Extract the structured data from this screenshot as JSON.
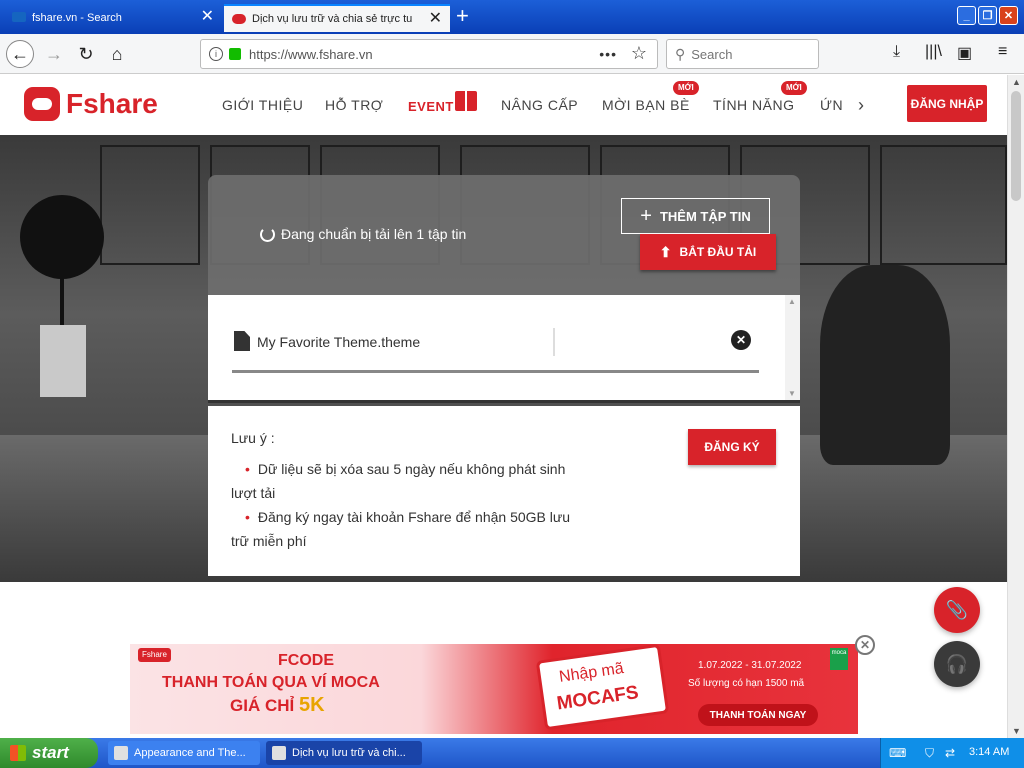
{
  "browser": {
    "tabs": [
      {
        "label": "fshare.vn - Search",
        "active": false
      },
      {
        "label": "Dịch vụ lưu trữ và chia sẻ trực tuyến",
        "active": true
      }
    ],
    "url": "https://www.fshare.vn",
    "search_placeholder": "Search"
  },
  "site": {
    "logo_text": "Fshare",
    "menu": [
      {
        "label": "GIỚI THIỆU"
      },
      {
        "label": "HỖ TRỢ"
      },
      {
        "label": "EVENT"
      },
      {
        "label": "NÂNG CẤP"
      },
      {
        "label": "MỜI BẠN BÈ",
        "badge": "MỚI"
      },
      {
        "label": "TÍNH NĂNG",
        "badge": "MỚI"
      },
      {
        "label": "ỨN"
      }
    ],
    "login_label": "ĐĂNG NHẬP"
  },
  "upload": {
    "status": "Đang chuẩn bị tải lên 1 tập tin",
    "add_label": "THÊM TẬP TIN",
    "start_label": "BẮT ĐẦU TẢI",
    "file_name": "My Favorite Theme.theme",
    "note_title": "Lưu ý :",
    "notes": [
      "Dữ liệu sẽ bị xóa sau 5 ngày nếu không phát sinh lượt tải",
      "Đăng ký ngay tài khoản Fshare để nhận 50GB lưu trữ miễn phí"
    ],
    "register_label": "ĐĂNG KÝ"
  },
  "banner": {
    "logo": "Fshare",
    "line1": "FCODE",
    "line2": "THANH TOÁN QUA VÍ MOCA",
    "line3a": "GIÁ CHỈ",
    "line3b": "5K",
    "ticket1": "Nhập mã",
    "ticket2": "MOCAFS",
    "dates": "1.07.2022 - 31.07.2022",
    "qty": "Số lượng có hạn 1500 mã",
    "pay": "THANH TOÁN NGAY",
    "moca": "moca"
  },
  "taskbar": {
    "start": "start",
    "tasks": [
      {
        "label": "Appearance and The..."
      },
      {
        "label": "Dịch vụ lưu trữ và chi..."
      }
    ],
    "time": "3:14 AM"
  }
}
